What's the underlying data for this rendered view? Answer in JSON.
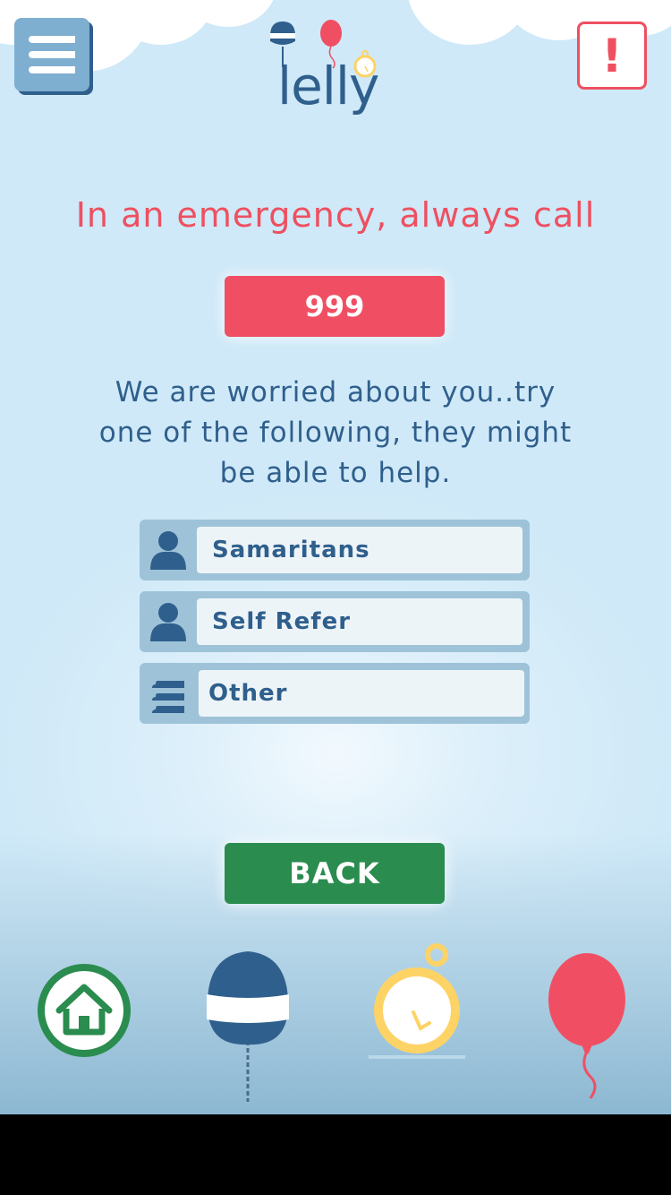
{
  "app": {
    "logo_text": "lelly",
    "alert_label": "!"
  },
  "emergency": {
    "heading": "In an emergency, always call",
    "number": "999"
  },
  "message": "We are worried about you..try one of the following, they might be able to help.",
  "options": [
    {
      "label": "Samaritans",
      "icon": "person-icon"
    },
    {
      "label": "Self Refer",
      "icon": "person-icon"
    },
    {
      "label": "Other",
      "icon": "menu-lines-icon"
    }
  ],
  "back_label": "BACK",
  "bottom_nav": [
    {
      "icon": "home-icon"
    },
    {
      "icon": "buoy-icon"
    },
    {
      "icon": "stopwatch-icon"
    },
    {
      "icon": "balloon-icon"
    }
  ],
  "colors": {
    "accent_red": "#f04f63",
    "brand_blue": "#2f5f8c",
    "back_green": "#2a8c4e",
    "stopwatch_yellow": "#fdd365"
  }
}
